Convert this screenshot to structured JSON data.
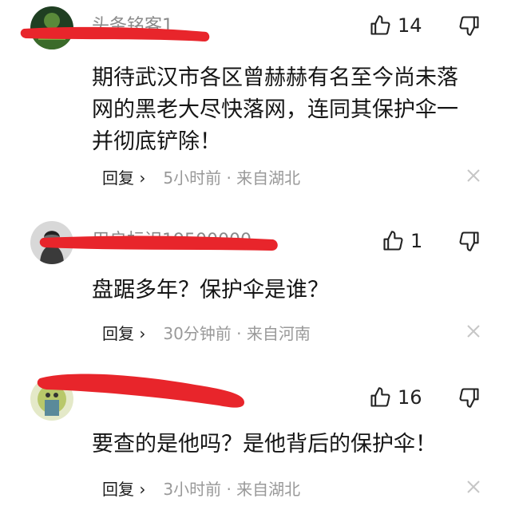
{
  "comments": [
    {
      "username": "头条铭客1",
      "likes": "14",
      "content": "期待武汉市各区曾赫赫有名至今尚未落\n网的黑老大尽快落网，连同其保护伞一\n并彻底铲除！",
      "reply_label": "回复 ›",
      "meta": "5小时前 · 来自湖北"
    },
    {
      "username": "用户标识19500000",
      "likes": "1",
      "content": "盘踞多年？保护伞是谁？",
      "reply_label": "回复 ›",
      "meta": "30分钟前 · 来自河南"
    },
    {
      "username": "",
      "likes": "16",
      "content": "要查的是他吗？是他背后的保护伞！",
      "reply_label": "回复 ›",
      "meta": "3小时前 · 来自湖北"
    }
  ],
  "colors": {
    "redaction": "#e8252b",
    "meta_gray": "#999999",
    "close_gray": "#c6c6c6"
  }
}
